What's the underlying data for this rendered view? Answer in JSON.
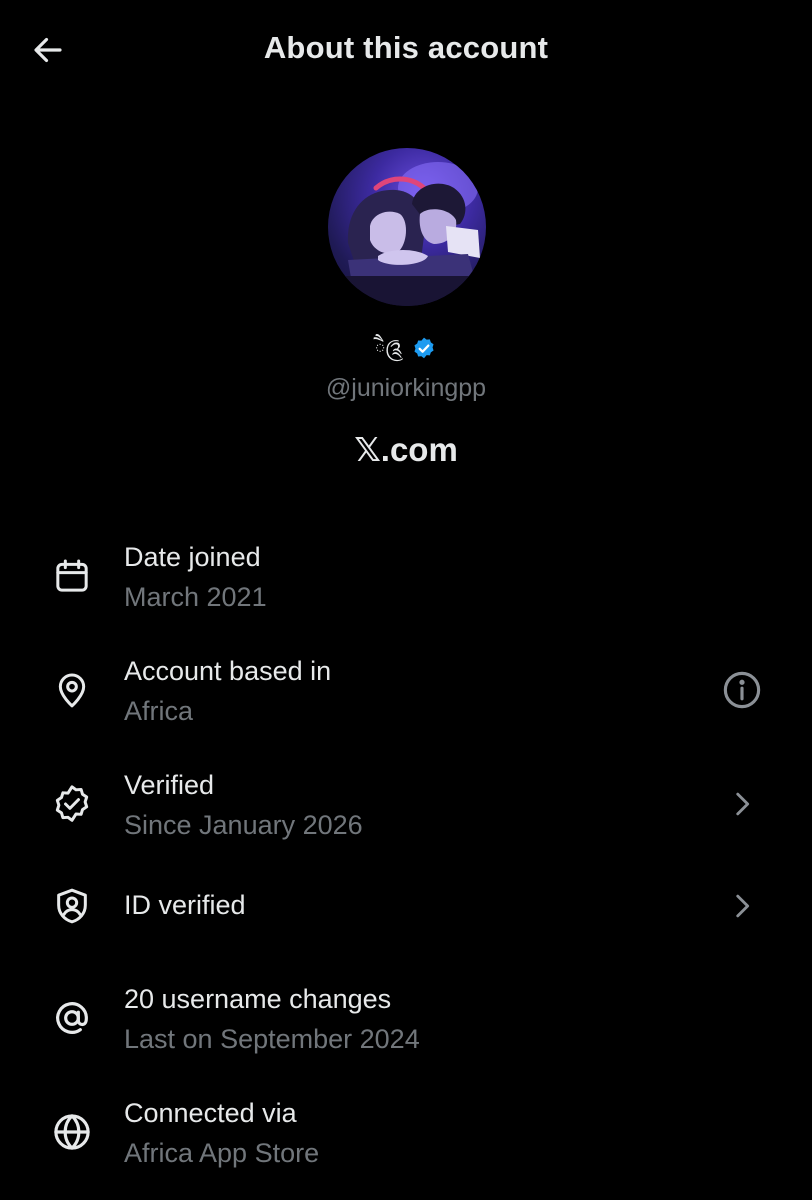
{
  "header": {
    "title": "About this account",
    "back_icon": "arrow-left-icon"
  },
  "profile": {
    "display_name": "ཻ༊",
    "verified_badge": "verified-badge-icon",
    "handle": "@juniorkingpp",
    "site": "𝕏.com"
  },
  "info": {
    "date_joined": {
      "icon": "calendar-icon",
      "title": "Date joined",
      "value": "March 2021"
    },
    "based_in": {
      "icon": "location-pin-icon",
      "title": "Account based in",
      "value": "Africa",
      "action_icon": "info-icon"
    },
    "verified": {
      "icon": "verified-badge-outline-icon",
      "title": "Verified",
      "value": "Since January 2026",
      "action_icon": "chevron-right-icon"
    },
    "id_verified": {
      "icon": "shield-user-icon",
      "title": "ID verified",
      "action_icon": "chevron-right-icon"
    },
    "username_changes": {
      "icon": "at-sign-icon",
      "title": "20 username changes",
      "value": "Last on September 2024"
    },
    "connected_via": {
      "icon": "globe-icon",
      "title": "Connected via",
      "value": "Africa App Store"
    }
  },
  "colors": {
    "background": "#000000",
    "primary_text": "#e7e9ea",
    "secondary_text": "#71767b",
    "verified_blue": "#1d9bf0"
  }
}
